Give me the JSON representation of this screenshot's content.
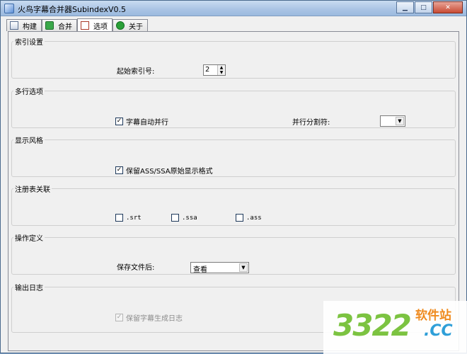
{
  "window": {
    "title": "火鸟字幕合并器SubindexV0.5",
    "buttons": {
      "minimize": "▁",
      "maximize": "□",
      "close": "✕"
    }
  },
  "tabs": [
    {
      "label": "构建",
      "icon": "document-icon"
    },
    {
      "label": "合并",
      "icon": "merge-icon"
    },
    {
      "label": "选项",
      "icon": "options-icon",
      "active": true
    },
    {
      "label": "关于",
      "icon": "info-icon"
    }
  ],
  "sections": {
    "index": {
      "title": "索引设置",
      "start_label": "起始索引号:",
      "start_value": "2"
    },
    "multiline": {
      "title": "多行选项",
      "auto_merge_label": "字幕自动并行",
      "auto_merge_checked": true,
      "separator_label": "并行分割符:",
      "separator_value": ""
    },
    "style": {
      "title": "显示风格",
      "keep_format_label": "保留ASS/SSA原始显示格式",
      "keep_format_checked": true
    },
    "registry": {
      "title": "注册表关联",
      "srt_label": ".srt",
      "ssa_label": ".ssa",
      "ass_label": ".ass"
    },
    "action": {
      "title": "操作定义",
      "after_save_label": "保存文件后:",
      "after_save_value": "查看"
    },
    "log": {
      "title": "输出日志",
      "keep_log_label": "保留字幕生成日志",
      "keep_log_checked": true
    }
  },
  "watermark": {
    "number": "3322",
    "top": "软件站",
    "domain": ".CC"
  }
}
